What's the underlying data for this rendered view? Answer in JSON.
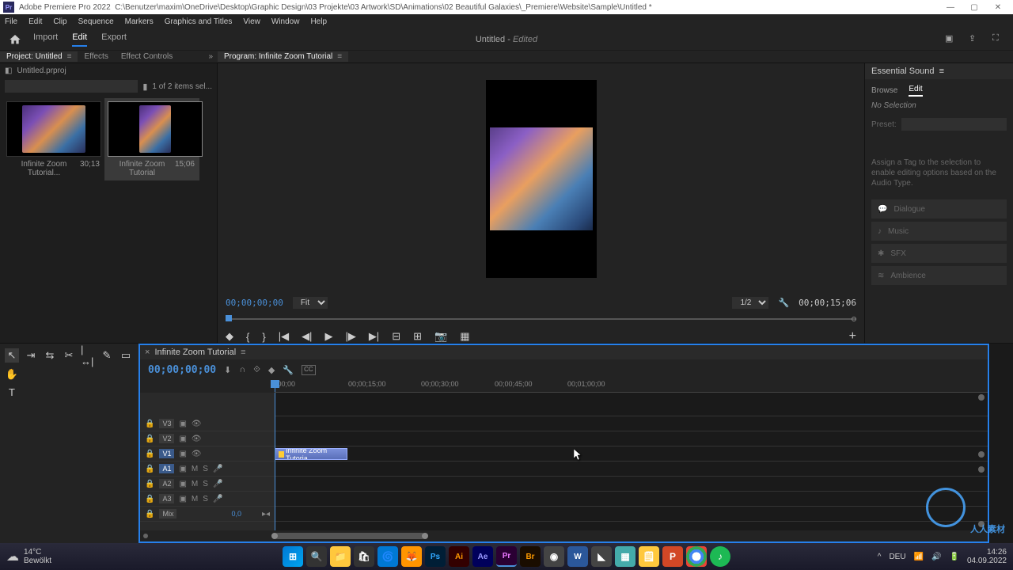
{
  "app": {
    "name": "Adobe Premiere Pro 2022",
    "filepath": "C:\\Benutzer\\maxim\\OneDrive\\Desktop\\Graphic Design\\03 Projekte\\03 Artwork\\SD\\Animations\\02 Beautiful Galaxies\\_Premiere\\Website\\Sample\\Untitled *"
  },
  "menu": {
    "items": [
      "File",
      "Edit",
      "Clip",
      "Sequence",
      "Markers",
      "Graphics and Titles",
      "View",
      "Window",
      "Help"
    ]
  },
  "workspace": {
    "tabs": [
      "Import",
      "Edit",
      "Export"
    ],
    "active": "Edit",
    "doc": "Untitled",
    "state": "Edited"
  },
  "panel_row_left": {
    "project": "Project: Untitled",
    "effects": "Effects",
    "effect_controls": "Effect Controls"
  },
  "panel_row_right": {
    "program": "Program: Infinite Zoom Tutorial"
  },
  "project": {
    "breadcrumb": "Untitled.prproj",
    "search_placeholder": "",
    "selection_info": "1 of 2 items sel...",
    "items": [
      {
        "name": "Infinite Zoom Tutorial...",
        "dur": "30;13"
      },
      {
        "name": "Infinite Zoom Tutorial",
        "dur": "15;06"
      }
    ]
  },
  "program": {
    "tc_in": "00;00;00;00",
    "fit": "Fit",
    "res": "1/2",
    "dur": "00;00;15;06"
  },
  "essential_sound": {
    "title": "Essential Sound",
    "tabs": [
      "Browse",
      "Edit"
    ],
    "nosel": "No Selection",
    "preset": "Preset:",
    "desc": "Assign a Tag to the selection to enable editing options based on the Audio Type.",
    "types": [
      "Dialogue",
      "Music",
      "SFX",
      "Ambience"
    ]
  },
  "timeline": {
    "seq_name": "Infinite Zoom Tutorial",
    "tc": "00;00;00;00",
    "ticks": [
      ";00;00",
      "00;00;15;00",
      "00;00;30;00",
      "00;00;45;00",
      "00;01;00;00"
    ],
    "vtracks": [
      "V3",
      "V2",
      "V1"
    ],
    "atracks": [
      "A1",
      "A2",
      "A3"
    ],
    "mix": "Mix",
    "mix_val": "0,0",
    "clip": "Infinite Zoom Tutoria"
  },
  "taskbar": {
    "temp": "14°C",
    "cond": "Bewölkt",
    "time": "14:26",
    "date": "04.09.2022"
  },
  "watermark": "人人素材"
}
